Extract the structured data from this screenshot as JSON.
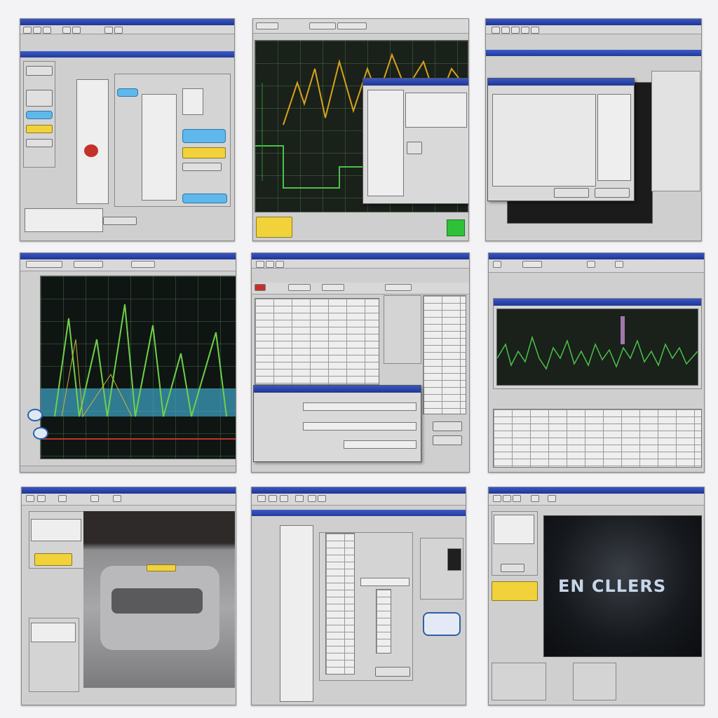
{
  "collage": {
    "tiles": [
      {
        "id": "tile-1",
        "kind": "settings-panel"
      },
      {
        "id": "tile-2",
        "kind": "oscilloscope-with-dialog"
      },
      {
        "id": "tile-3",
        "kind": "modal-dialog"
      },
      {
        "id": "tile-4",
        "kind": "waveform-graph"
      },
      {
        "id": "tile-5",
        "kind": "data-table-form"
      },
      {
        "id": "tile-6",
        "kind": "signal-monitor-table"
      },
      {
        "id": "tile-7",
        "kind": "vehicle-view"
      },
      {
        "id": "tile-8",
        "kind": "form-list"
      },
      {
        "id": "tile-9",
        "kind": "splash-screen"
      }
    ]
  },
  "splash": {
    "logo_text": "EN CLLERS"
  },
  "colors": {
    "titlebar": "#1e3594",
    "window_gray": "#cfcfcf",
    "scope_bg": "#1a201a",
    "trace_yellow": "#d6a21c",
    "trace_green": "#49c24a",
    "accent_yellow": "#f2d23a",
    "accent_blue": "#5fb8ec",
    "accent_red": "#c3322a",
    "splash_bg": "#0b0d10"
  },
  "icons": [
    "toolbar-button-icon",
    "window-close-icon",
    "power-green-icon",
    "speaker-icon",
    "car-icon",
    "gear-icon"
  ]
}
